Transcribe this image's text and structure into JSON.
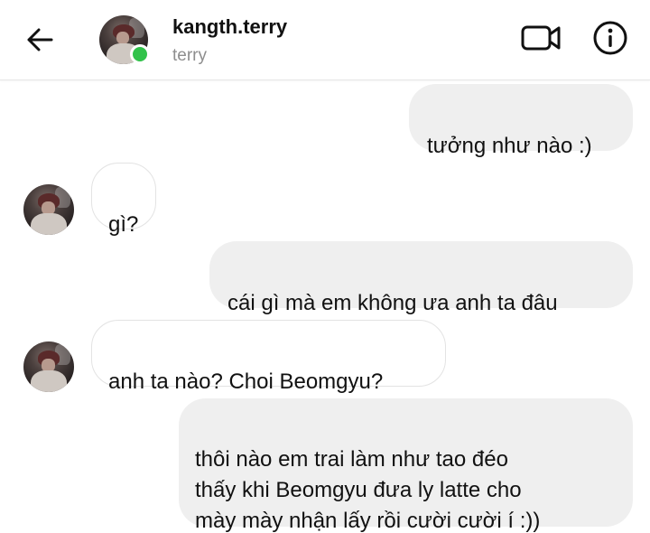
{
  "header": {
    "contact_name": "kangth.terry",
    "contact_subtitle": "terry",
    "online": true,
    "back_icon": "arrow-left-icon",
    "video_icon": "video-camera-icon",
    "info_icon": "info-icon"
  },
  "messages": [
    {
      "direction": "outgoing",
      "text": "tưởng như nào :)"
    },
    {
      "direction": "incoming",
      "text": "gì?"
    },
    {
      "direction": "outgoing",
      "text": "cái gì mà em không ưa anh ta đâu"
    },
    {
      "direction": "incoming",
      "text": "anh ta nào? Choi Beomgyu?"
    },
    {
      "direction": "outgoing",
      "text": "thôi nào em trai làm như tao đéo\nthấy khi Beomgyu đưa ly latte cho\nmày mày nhận lấy rồi cười cười í :))"
    }
  ],
  "colors": {
    "outgoing_bubble": "#efefef",
    "incoming_border": "#e3e3e3",
    "online_dot": "#31c24a",
    "subtitle": "#8e8e8e"
  }
}
